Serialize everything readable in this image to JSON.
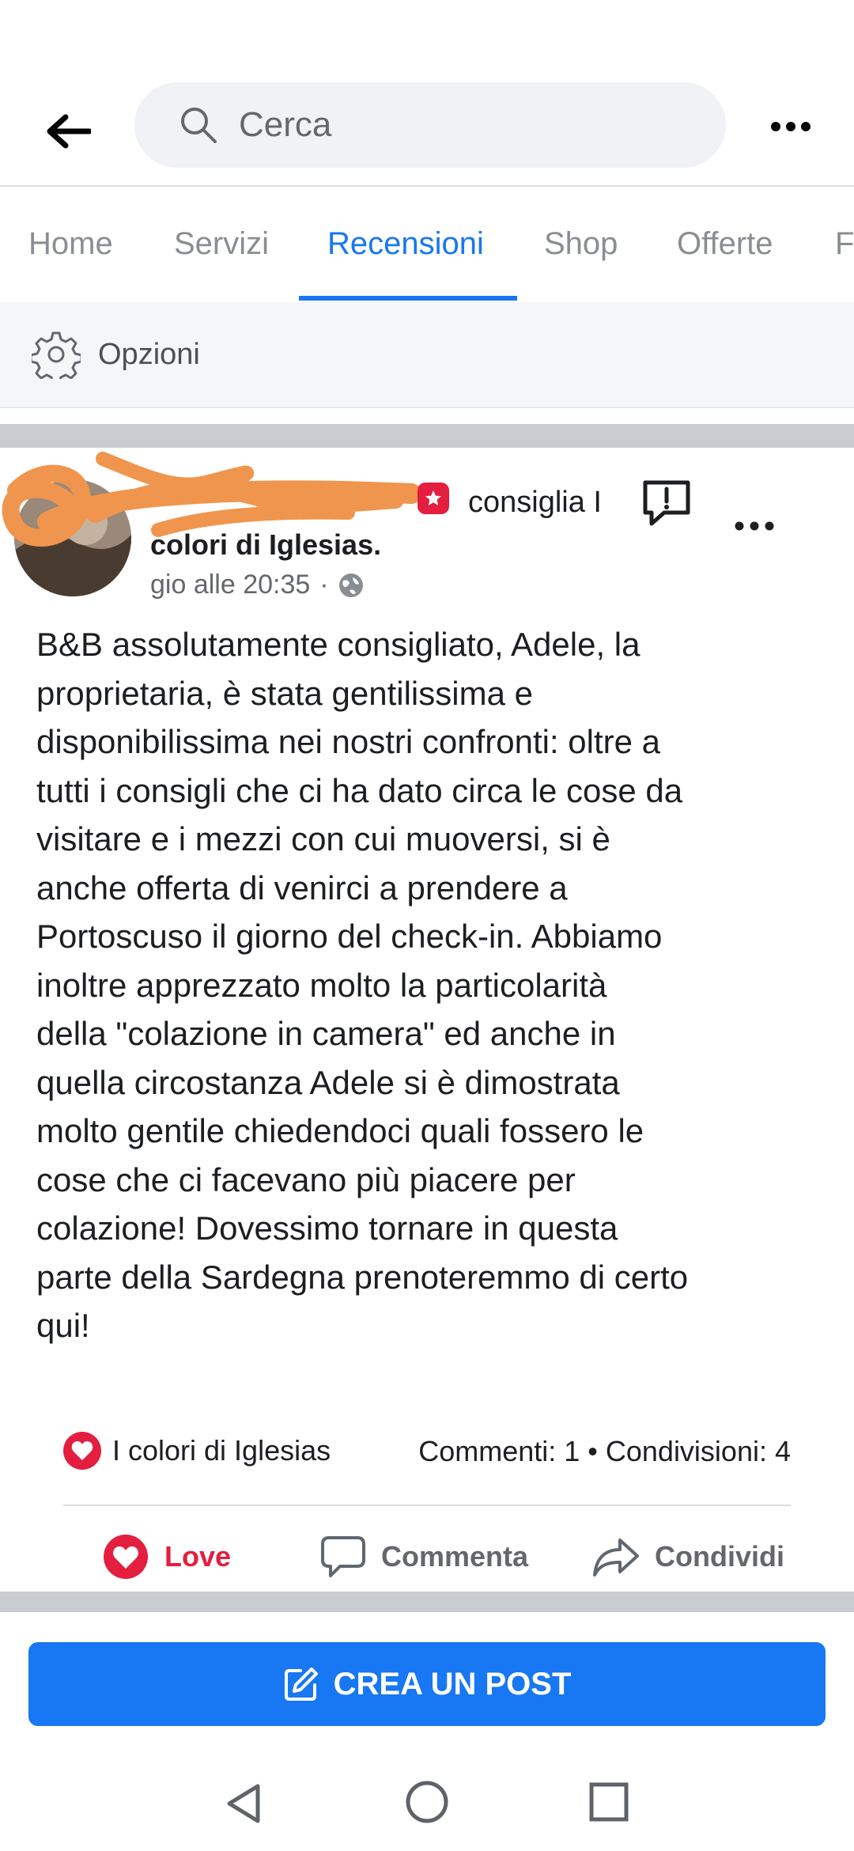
{
  "search": {
    "placeholder": "Cerca"
  },
  "tabs": [
    {
      "label": "Home"
    },
    {
      "label": "Servizi"
    },
    {
      "label": "Recensioni"
    },
    {
      "label": "Shop"
    },
    {
      "label": "Offerte"
    },
    {
      "label": "F"
    }
  ],
  "active_tab": "Recensioni",
  "options": {
    "label": "Opzioni"
  },
  "post": {
    "header_action": "consiglia I",
    "page_name": "colori di Iglesias.",
    "time": "gio alle 20:35",
    "visibility_separator": "·",
    "body": "B&B assolutamente consigliato, Adele, la\nproprietaria, è stata gentilissima e\ndisponibilissima nei nostri confronti: oltre a\ntutti i consigli che ci ha dato circa le cose da\nvisitare e i mezzi con cui muoversi, si è\nanche offerta di venirci a prendere a\nPortoscuso il giorno del check-in. Abbiamo\ninoltre apprezzato molto la particolarità\ndella \"colazione in camera\" ed anche in\nquella circostanza Adele si è dimostrata\nmolto gentile chiedendoci quali fossero le\ncose che ci facevano più piacere per\ncolazione! Dovessimo tornare in questa\nparte della Sardegna prenoteremmo di certo\nqui!",
    "reactions_by": "I colori di Iglesias",
    "counts": "Commenti: 1 • Condivisioni: 4"
  },
  "actions": {
    "love": "Love",
    "comment": "Commenta",
    "share": "Condividi"
  },
  "create_post": {
    "label": "CREA UN POST"
  },
  "colors": {
    "accent": "#1877f2",
    "love": "#e41e3f",
    "redaction": "#f0954d"
  },
  "icons": [
    "back-arrow-icon",
    "search-icon",
    "more-icon",
    "gear-icon",
    "recommend-icon",
    "report-icon",
    "globe-icon",
    "heart-icon",
    "comment-icon",
    "share-icon",
    "edit-icon",
    "nav-back-icon",
    "nav-home-icon",
    "nav-recent-icon"
  ]
}
